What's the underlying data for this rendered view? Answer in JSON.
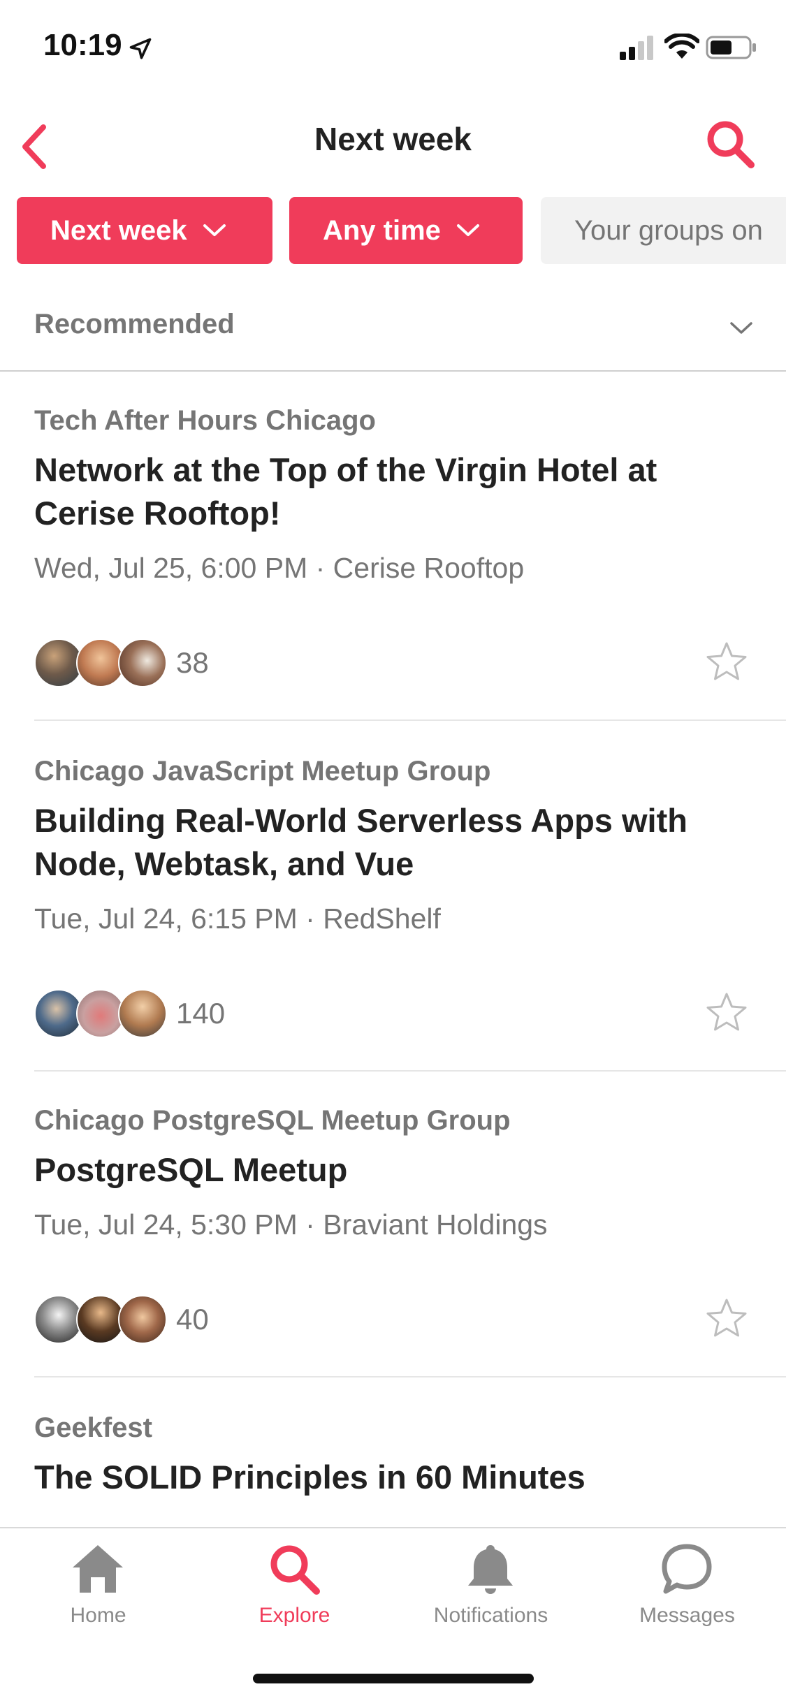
{
  "status_bar": {
    "time": "10:19"
  },
  "nav": {
    "title": "Next week"
  },
  "filters": [
    {
      "label": "Next week",
      "active": true
    },
    {
      "label": "Any time",
      "active": true
    },
    {
      "label": "Your groups on",
      "active": false
    }
  ],
  "sort": {
    "label": "Recommended"
  },
  "events": [
    {
      "group": "Tech After Hours Chicago",
      "title": "Network at the Top of the Virgin Hotel at Cerise Rooftop!",
      "when": "Wed, Jul 25, 6:00 PM · Cerise Rooftop",
      "attendees": "38"
    },
    {
      "group": "Chicago JavaScript Meetup Group",
      "title": "Building Real-World Serverless Apps with Node, Webtask, and Vue",
      "when": "Tue, Jul 24, 6:15 PM · RedShelf",
      "attendees": "140"
    },
    {
      "group": "Chicago PostgreSQL Meetup Group",
      "title": "PostgreSQL Meetup",
      "when": "Tue, Jul 24, 5:30 PM · Braviant Holdings",
      "attendees": "40"
    },
    {
      "group": "Geekfest",
      "title": "The SOLID Principles in 60 Minutes",
      "when": "",
      "attendees": ""
    }
  ],
  "tabs": [
    {
      "label": "Home",
      "icon": "home-icon",
      "active": false
    },
    {
      "label": "Explore",
      "icon": "search-icon",
      "active": true
    },
    {
      "label": "Notifications",
      "icon": "bell-icon",
      "active": false
    },
    {
      "label": "Messages",
      "icon": "chat-bubble-icon",
      "active": false
    }
  ],
  "colors": {
    "accent": "#f03c5a",
    "text_muted": "#757575",
    "text_primary": "#222222"
  }
}
